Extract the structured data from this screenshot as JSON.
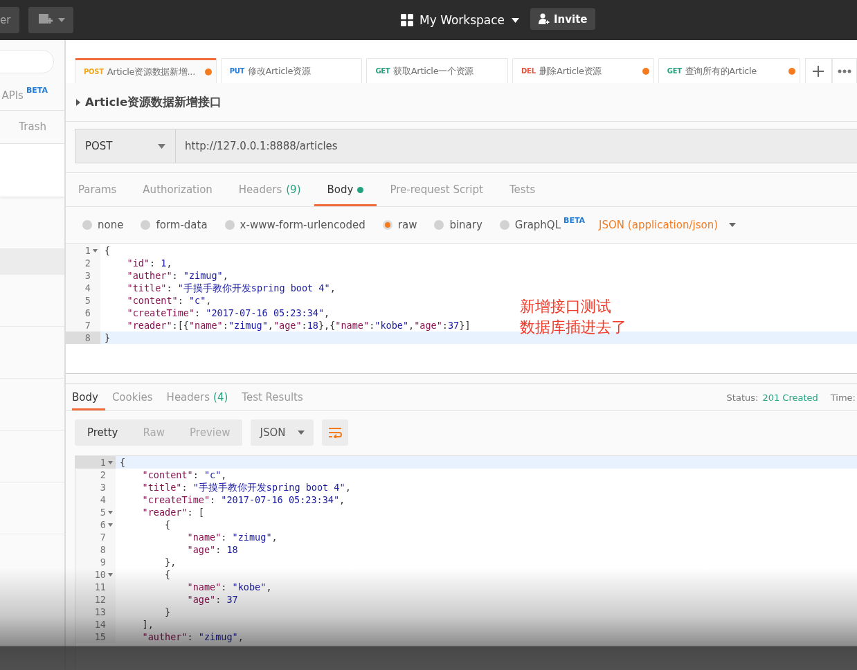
{
  "topbar": {
    "left_button": "er",
    "workspace": "My Workspace",
    "invite": "Invite"
  },
  "sidebar": {
    "apis": "APIs",
    "apis_badge": "BETA",
    "trash": "Trash",
    "rows": [
      {
        "selected": false
      },
      {
        "selected": true
      },
      {
        "selected": false
      },
      {
        "selected": false
      },
      {
        "selected": false
      },
      {
        "selected": false
      },
      {
        "selected": false
      }
    ]
  },
  "tabs": [
    {
      "method": "POST",
      "color": "#f0a818",
      "title": "Article资源数据新增...",
      "selected": true,
      "modified": true
    },
    {
      "method": "PUT",
      "color": "#1f7ad8",
      "title": "修改Article资源",
      "selected": false,
      "modified": false
    },
    {
      "method": "GET",
      "color": "#26a17e",
      "title": "获取Article一个资源",
      "selected": false,
      "modified": false
    },
    {
      "method": "DEL",
      "color": "#e0533c",
      "title": "删除Article资源",
      "selected": false,
      "modified": true
    },
    {
      "method": "GET",
      "color": "#26a17e",
      "title": "查询所有的Article",
      "selected": false,
      "modified": true
    }
  ],
  "request": {
    "name": "Article资源数据新增接口",
    "method": "POST",
    "url": "http://127.0.0.1:8888/articles",
    "tabs": [
      {
        "label": "Params",
        "selected": false
      },
      {
        "label": "Authorization",
        "selected": false
      },
      {
        "label": "Headers",
        "count": "(9)",
        "selected": false
      },
      {
        "label": "Body",
        "selected": true,
        "dot": true
      },
      {
        "label": "Pre-request Script",
        "selected": false
      },
      {
        "label": "Tests",
        "selected": false
      }
    ],
    "body_types": [
      {
        "label": "none",
        "selected": false
      },
      {
        "label": "form-data",
        "selected": false
      },
      {
        "label": "x-www-form-urlencoded",
        "selected": false
      },
      {
        "label": "raw",
        "selected": true
      },
      {
        "label": "binary",
        "selected": false
      },
      {
        "label": "GraphQL",
        "badge": "BETA",
        "selected": false
      }
    ],
    "content_type": "JSON (application/json)",
    "code": [
      {
        "n": "1",
        "text": "{",
        "fold": true,
        "current": false
      },
      {
        "n": "2",
        "text": "    \"id\": 1,",
        "fold": false,
        "current": false
      },
      {
        "n": "3",
        "text": "    \"auther\": \"zimug\",",
        "fold": false,
        "current": false
      },
      {
        "n": "4",
        "text": "    \"title\": \"手摸手教你开发spring boot 4\",",
        "fold": false,
        "current": false
      },
      {
        "n": "5",
        "text": "    \"content\": \"c\",",
        "fold": false,
        "current": false
      },
      {
        "n": "6",
        "text": "    \"createTime\": \"2017-07-16 05:23:34\",",
        "fold": false,
        "current": false
      },
      {
        "n": "7",
        "text": "    \"reader\":[{\"name\":\"zimug\",\"age\":18},{\"name\":\"kobe\",\"age\":37}]",
        "fold": false,
        "current": false
      },
      {
        "n": "8",
        "text": "}",
        "fold": false,
        "current": true
      }
    ],
    "annotation": [
      "新增接口测试",
      "数据库插进去了"
    ]
  },
  "response": {
    "tabs": [
      {
        "label": "Body",
        "selected": true
      },
      {
        "label": "Cookies",
        "selected": false
      },
      {
        "label": "Headers",
        "count": "(4)",
        "selected": false
      },
      {
        "label": "Test Results",
        "selected": false
      }
    ],
    "status_label": "Status:",
    "status": "201 Created",
    "time_label": "Time:",
    "view_modes": [
      {
        "label": "Pretty",
        "selected": true
      },
      {
        "label": "Raw",
        "selected": false
      },
      {
        "label": "Preview",
        "selected": false
      }
    ],
    "format": "JSON",
    "code": [
      {
        "n": "1",
        "text": "{",
        "fold": true,
        "current": true
      },
      {
        "n": "2",
        "text": "    \"content\": \"c\",",
        "fold": false,
        "current": false
      },
      {
        "n": "3",
        "text": "    \"title\": \"手摸手教你开发spring boot 4\",",
        "fold": false,
        "current": false
      },
      {
        "n": "4",
        "text": "    \"createTime\": \"2017-07-16 05:23:34\",",
        "fold": false,
        "current": false
      },
      {
        "n": "5",
        "text": "    \"reader\": [",
        "fold": true,
        "current": false
      },
      {
        "n": "6",
        "text": "        {",
        "fold": true,
        "current": false
      },
      {
        "n": "7",
        "text": "            \"name\": \"zimug\",",
        "fold": false,
        "current": false
      },
      {
        "n": "8",
        "text": "            \"age\": 18",
        "fold": false,
        "current": false
      },
      {
        "n": "9",
        "text": "        },",
        "fold": false,
        "current": false
      },
      {
        "n": "10",
        "text": "        {",
        "fold": true,
        "current": false
      },
      {
        "n": "11",
        "text": "            \"name\": \"kobe\",",
        "fold": false,
        "current": false
      },
      {
        "n": "12",
        "text": "            \"age\": 37",
        "fold": false,
        "current": false
      },
      {
        "n": "13",
        "text": "        }",
        "fold": false,
        "current": false
      },
      {
        "n": "14",
        "text": "    ],",
        "fold": false,
        "current": false
      },
      {
        "n": "15",
        "text": "    \"auther\": \"zimug\",",
        "fold": false,
        "current": false
      }
    ]
  }
}
